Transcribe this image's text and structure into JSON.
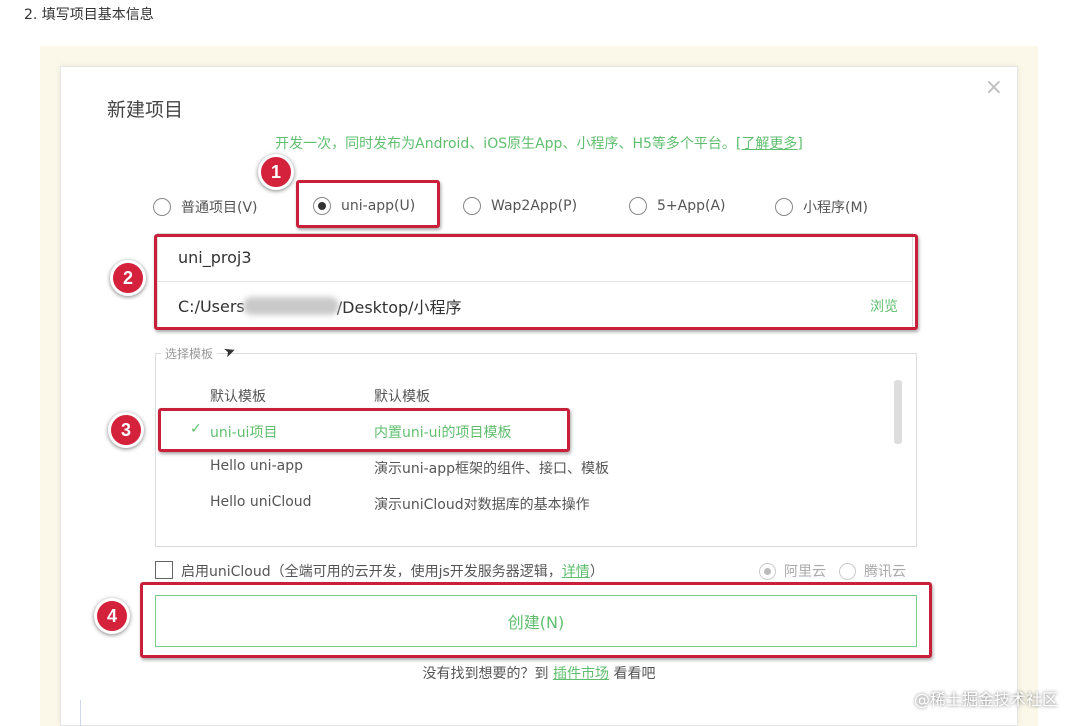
{
  "page": {
    "step_heading": "2. 填写项目基本信息",
    "watermark": "@稀土掘金技术社区"
  },
  "dialog": {
    "title": "新建项目",
    "close_glyph": "×",
    "tagline": "开发一次，同时发布为Android、iOS原生App、小程序、H5等多个平台。",
    "tagline_link": "[了解更多]",
    "project_types": [
      {
        "label": "普通项目(V)",
        "selected": false
      },
      {
        "label": "uni-app(U)",
        "selected": true
      },
      {
        "label": "Wap2App(P)",
        "selected": false
      },
      {
        "label": "5+App(A)",
        "selected": false
      },
      {
        "label": "小程序(M)",
        "selected": false
      }
    ],
    "project_name": "uni_proj3",
    "path_prefix": "C:/Users",
    "path_suffix": "/Desktop/小程序",
    "browse_label": "浏览",
    "templates_legend": "选择模板",
    "templates": [
      {
        "name": "默认模板",
        "desc": "默认模板",
        "selected": false
      },
      {
        "name": "uni-ui项目",
        "desc": "内置uni-ui的项目模板",
        "selected": true
      },
      {
        "name": "Hello uni-app",
        "desc": "演示uni-app框架的组件、接口、模板",
        "selected": false
      },
      {
        "name": "Hello uniCloud",
        "desc": "演示uniCloud对数据库的基本操作",
        "selected": false
      }
    ],
    "check_glyph": "✓",
    "unicloud_label": "启用uniCloud（全端可用的云开发，使用js开发服务器逻辑，",
    "unicloud_link": "详情",
    "unicloud_close": "）",
    "providers": [
      {
        "label": "阿里云",
        "selected": true
      },
      {
        "label": "腾讯云",
        "selected": false
      }
    ],
    "create_label": "创建(N)",
    "footer_prefix": "没有找到想要的？到",
    "footer_link": "插件市场",
    "footer_suffix": "看看吧"
  },
  "annotations": {
    "badge_1": "1",
    "badge_2": "2",
    "badge_3": "3",
    "badge_4": "4"
  },
  "colors": {
    "accent_green": "#5fbf6e",
    "annotation_red": "#c81f3a"
  }
}
